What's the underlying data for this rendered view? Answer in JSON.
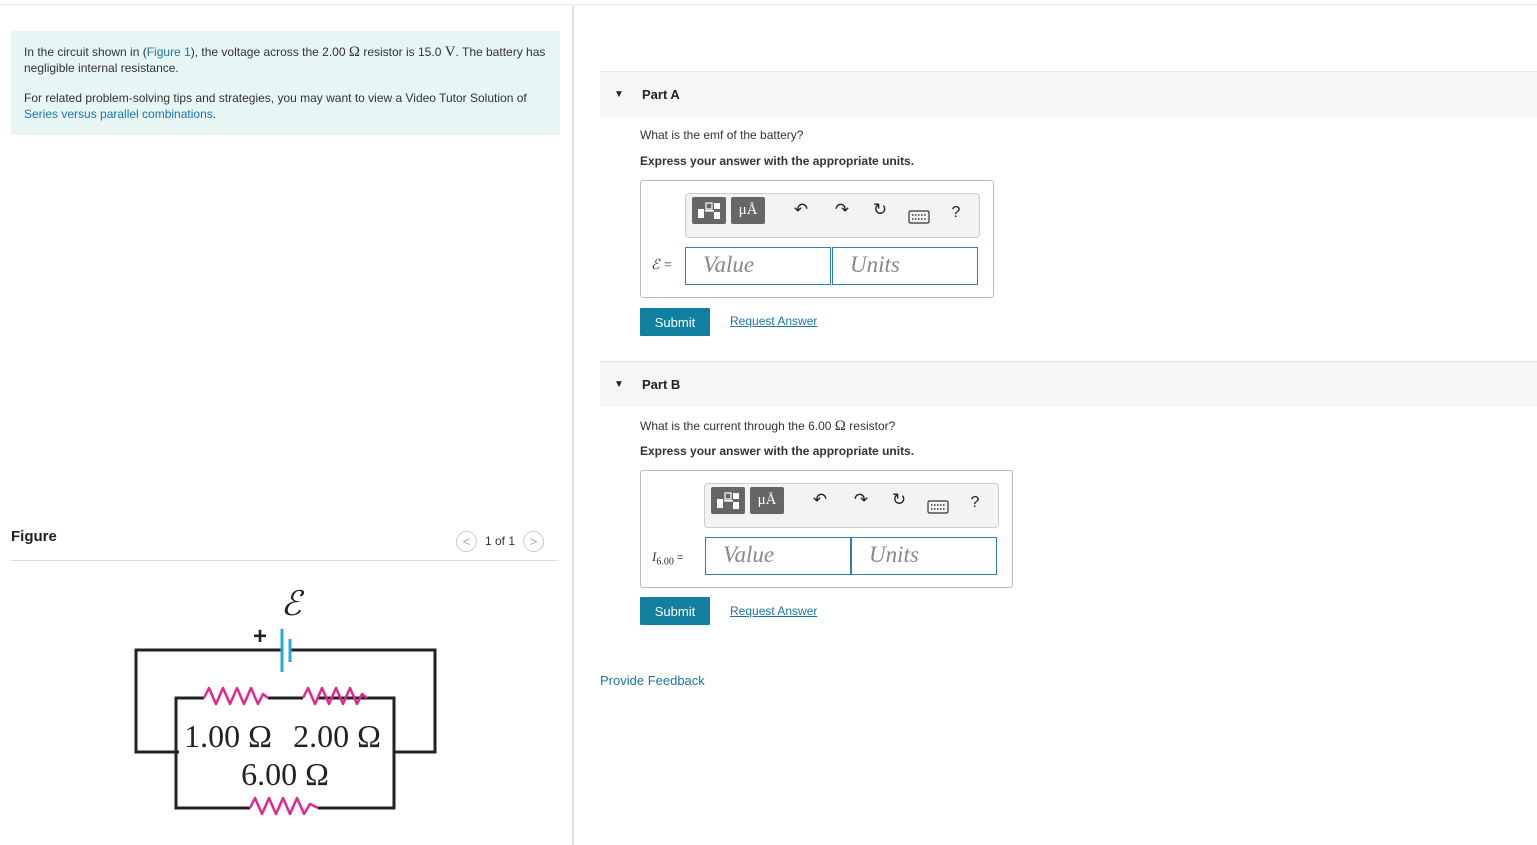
{
  "intro": {
    "line1_pre": "In the circuit shown in (",
    "figure_link": "Figure 1",
    "line1_mid": "), the voltage across the 2.00 ",
    "ohm": "Ω",
    "line1_mid2": " resistor is 15.0 ",
    "volt": "V",
    "line1_post": ". The battery has negligible internal resistance.",
    "line2_pre": "For related problem-solving tips and strategies, you may want to view a Video Tutor Solution of ",
    "video_link": "Series versus parallel combinations",
    "line2_post": "."
  },
  "figure": {
    "label": "Figure",
    "counter": "1 of 1",
    "prev_glyph": "<",
    "next_glyph": ">",
    "emf_symbol": "ℰ",
    "plus": "+",
    "r1": "1.00 Ω",
    "r2": "2.00 Ω",
    "r3": "6.00 Ω",
    "colors": {
      "wire": "#222222",
      "battery": "#29a8e0",
      "resistor": "#e0288c"
    }
  },
  "partA": {
    "title": "Part A",
    "question": "What is the emf of the battery?",
    "instruction": "Express your answer with the appropriate units.",
    "var_label": "ℰ =",
    "value_placeholder": "Value",
    "units_placeholder": "Units",
    "submit": "Submit",
    "request": "Request Answer"
  },
  "partB": {
    "title": "Part B",
    "question_pre": "What is the current through the 6.00 ",
    "ohm": "Ω",
    "question_post": " resistor?",
    "instruction": "Express your answer with the appropriate units.",
    "var_main": "I",
    "var_sub": "6.00",
    "var_eq": " =",
    "value_placeholder": "Value",
    "units_placeholder": "Units",
    "submit": "Submit",
    "request": "Request Answer"
  },
  "toolbar": {
    "mu_label": "μÅ",
    "undo_glyph": "↶",
    "redo_glyph": "↷",
    "reset_glyph": "↻",
    "help_glyph": "?",
    "icons": [
      "templates-icon",
      "units-icon",
      "undo-icon",
      "redo-icon",
      "reset-icon",
      "keyboard-icon",
      "help-icon"
    ]
  },
  "feedback": "Provide Feedback"
}
